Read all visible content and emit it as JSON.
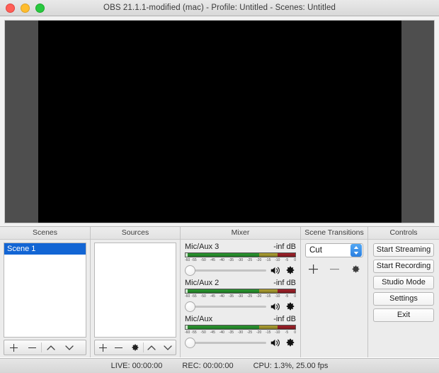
{
  "window": {
    "title": "OBS 21.1.1-modified (mac) - Profile: Untitled - Scenes: Untitled",
    "traffic_lights": [
      "close",
      "minimize",
      "zoom"
    ]
  },
  "preview": {
    "canvas_color": "#000000",
    "letterbox_color": "#4e4e4e"
  },
  "panels": {
    "scenes": {
      "title": "Scenes",
      "items": [
        {
          "label": "Scene 1",
          "selected": true
        }
      ],
      "toolbar": {
        "add": "+",
        "remove": "−",
        "up": "up-chevron",
        "down": "down-chevron"
      }
    },
    "sources": {
      "title": "Sources",
      "items": [],
      "toolbar": {
        "add": "+",
        "remove": "−",
        "properties": "gear",
        "up": "up-chevron",
        "down": "down-chevron"
      }
    },
    "mixer": {
      "title": "Mixer",
      "channels": [
        {
          "name": "Mic/Aux 3",
          "db": "-inf dB",
          "volume_percent": 0,
          "muted": false
        },
        {
          "name": "Mic/Aux 2",
          "db": "-inf dB",
          "volume_percent": 0,
          "muted": false
        },
        {
          "name": "Mic/Aux",
          "db": "-inf dB",
          "volume_percent": 0,
          "muted": false
        }
      ],
      "scale_ticks": [
        "-60",
        "-55",
        "-50",
        "-45",
        "-40",
        "-35",
        "-30",
        "-25",
        "-20",
        "-15",
        "-10",
        "-5",
        "0"
      ],
      "meter_colors": {
        "green": "#27952c",
        "yellow": "#a89b2f",
        "red": "#9b2028"
      }
    },
    "scene_transitions": {
      "title": "Scene Transitions",
      "selected_transition": "Cut",
      "options": [
        "Cut"
      ],
      "buttons": {
        "add": "+",
        "remove": "−",
        "properties": "gear"
      }
    },
    "controls": {
      "title": "Controls",
      "buttons": [
        "Start Streaming",
        "Start Recording",
        "Studio Mode",
        "Settings",
        "Exit"
      ]
    }
  },
  "statusbar": {
    "live": "LIVE: 00:00:00",
    "rec": "REC: 00:00:00",
    "cpu": "CPU: 1.3%, 25.00 fps"
  }
}
